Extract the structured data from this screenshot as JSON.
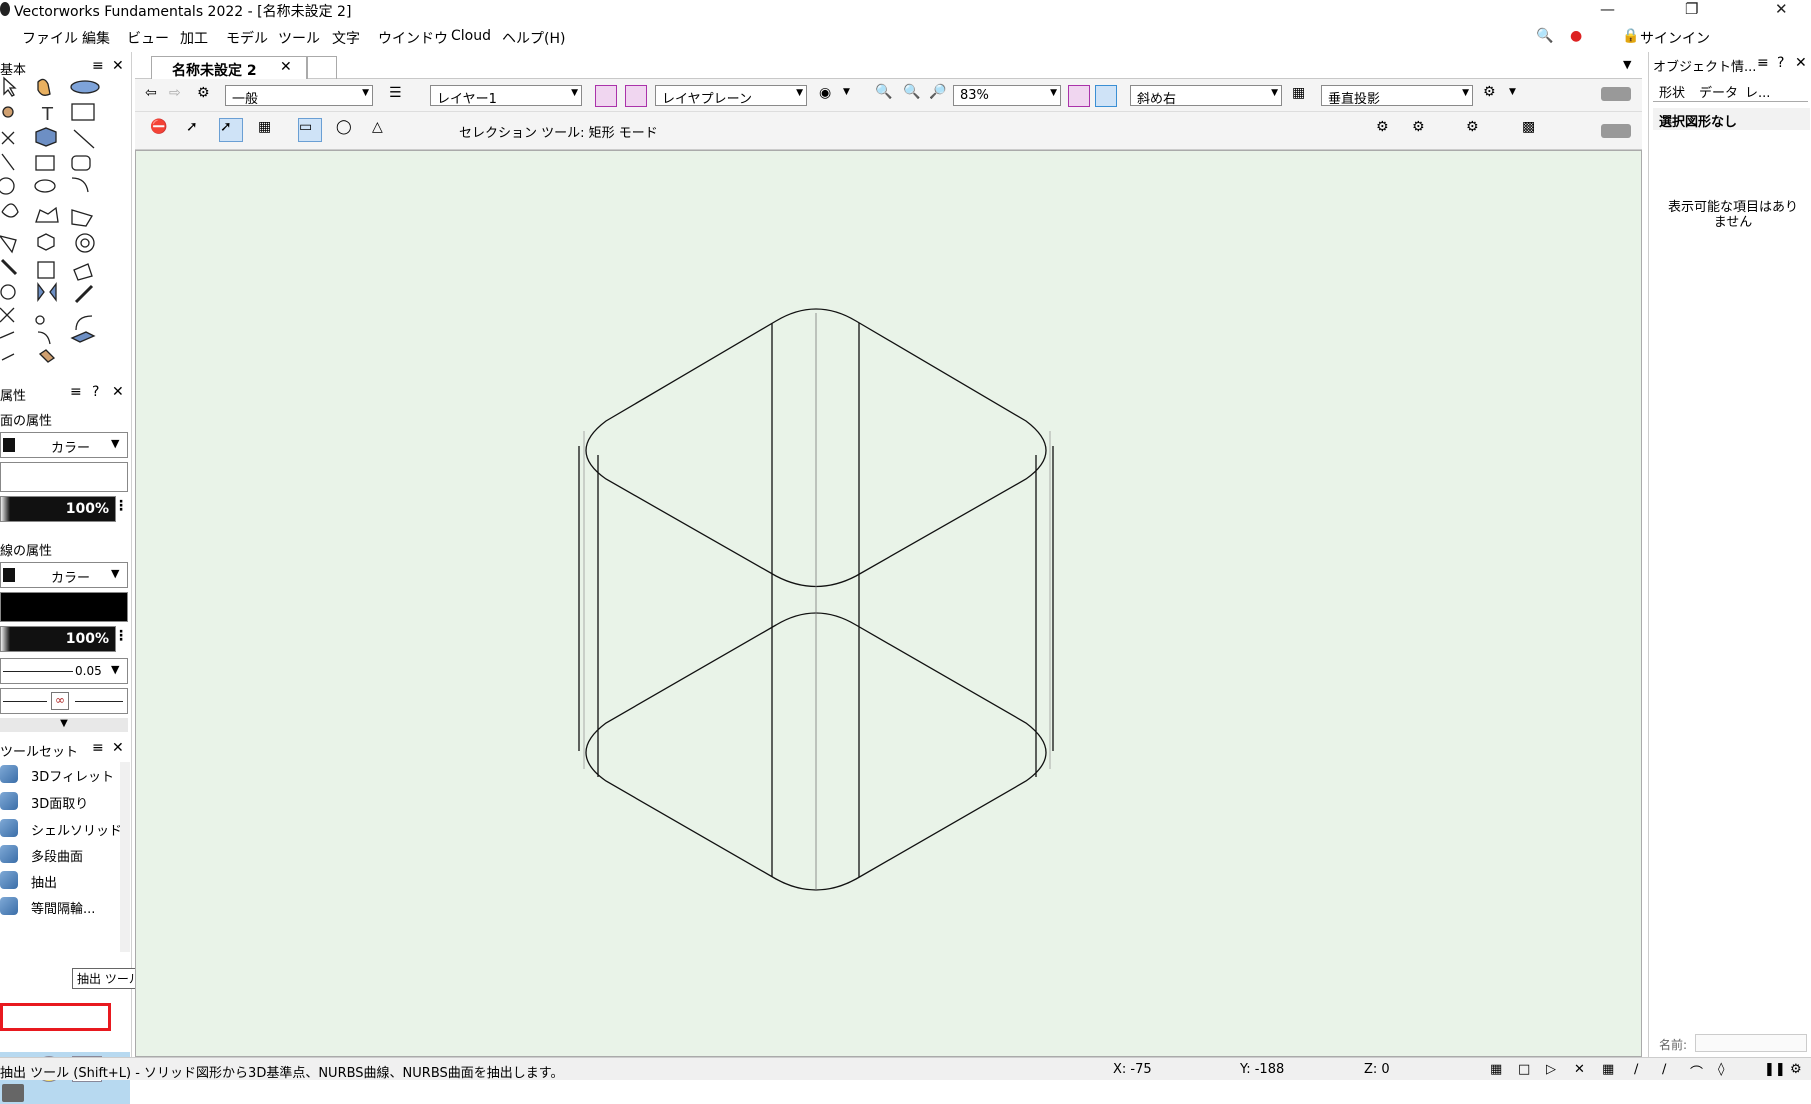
{
  "window": {
    "title": "Vectorworks Fundamentals 2022 - [名称未設定 2]"
  },
  "menu": [
    "ファイル",
    "編集",
    "ビュー",
    "加工",
    "モデル",
    "ツール",
    "文字",
    "ウインドウ",
    "Cloud",
    "ヘルプ(H)"
  ],
  "signin_label": "サインイン",
  "left": {
    "basic_title": "基本",
    "attributes_title": "属性",
    "fill_section": "面の属性",
    "line_section": "線の属性",
    "color_label": "カラー",
    "fill_opacity": "100%",
    "line_opacity": "100%",
    "line_weight": "0.05",
    "toolset_title": "ツールセット",
    "toolset_items": [
      "3Dフィレット",
      "3D面取り",
      "シェルソリッド",
      "多段曲面",
      "抽出",
      "等間隔輪..."
    ],
    "highlight_color": "#e8191f"
  },
  "doc_tab": "名称未設定 2",
  "viewbar": {
    "class_value": "一般",
    "layer_value": "レイヤー1",
    "plane_value": "レイヤプレーン",
    "zoom_value": "83%",
    "view_value": "斜め右",
    "projection_value": "垂直投影"
  },
  "modebar": {
    "mode_text": "セレクション ツール: 矩形 モード"
  },
  "annotation": {
    "step_number": "❶",
    "tooltip": "抽出 ツール (Shift+L)"
  },
  "right": {
    "title": "オブジェクト情...",
    "tabs": [
      "形状",
      "データ",
      "レ..."
    ],
    "header": "選択図形なし",
    "empty_message": "表示可能な項目はありません",
    "name_label": "名前:"
  },
  "status": {
    "message": "抽出 ツール (Shift+L) - ソリッド図形から3D基準点、NURBS曲線、NURBS曲面を抽出します。",
    "x": "X: -75",
    "y": "Y: -188",
    "z": "Z: 0"
  }
}
